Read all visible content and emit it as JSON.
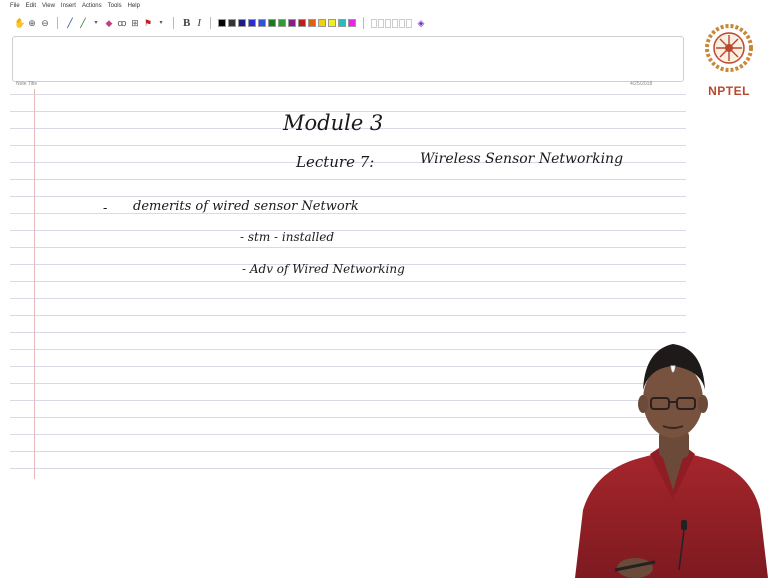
{
  "menu": [
    "File",
    "Edit",
    "View",
    "Insert",
    "Actions",
    "Tools",
    "Help"
  ],
  "toolbar": {
    "bold": "B",
    "italic": "I",
    "colors": [
      "#000000",
      "#333333",
      "#1a1a8c",
      "#2b2bd9",
      "#3050e0",
      "#1a7a1a",
      "#2aa02a",
      "#8a1a8a",
      "#c01a1a",
      "#e06010",
      "#f0d010",
      "#f0f020",
      "#20c0c0",
      "#f020f0"
    ]
  },
  "note": {
    "title_label": "Note Title",
    "date": "4/25/2018"
  },
  "logo": {
    "text": "NPTEL"
  },
  "notes": {
    "heading": "Module 3",
    "lecture": "Lecture 7:",
    "topic": "Wireless Sensor Networking",
    "bullet": "-",
    "line1": "demerits of wired sensor Network",
    "line2": "- stm - installed",
    "line3": "- Adv of Wired Networking"
  }
}
